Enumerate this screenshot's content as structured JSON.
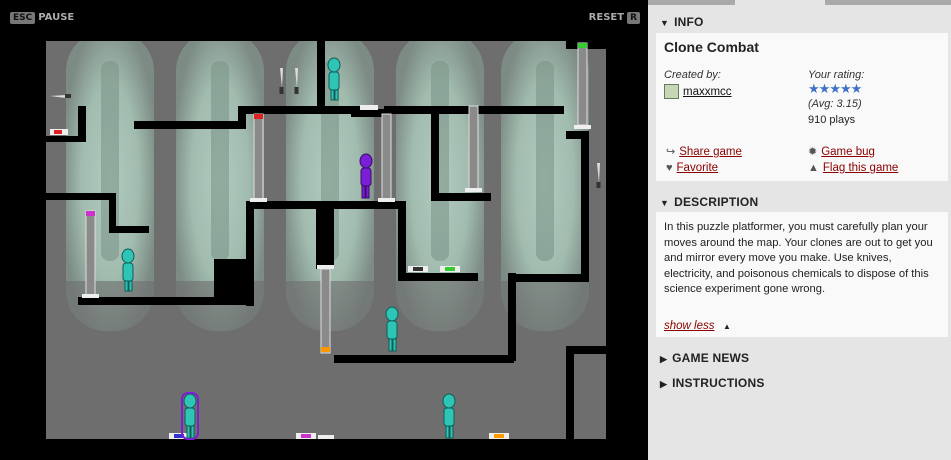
{
  "hud": {
    "esc_key": "ESC",
    "pause_label": "PAUSE",
    "reset_label": "RESET",
    "reset_key": "R"
  },
  "colors": {
    "link": "#8b0000",
    "clone_teal": "#2ec4b6",
    "player_purple": "#7b1fd6",
    "stars": "#3f72c4"
  },
  "info": {
    "header": "INFO",
    "title": "Clone Combat",
    "created_by_label": "Created by:",
    "author": "maxxmcc",
    "rating_label": "Your rating:",
    "avg": "(Avg: 3.15)",
    "plays": "910 plays",
    "stars": 5,
    "share": "Share game",
    "favorite": "Favorite",
    "bug": "Game bug",
    "flag": "Flag this game"
  },
  "description": {
    "header": "DESCRIPTION",
    "text": "In this puzzle platformer, you must carefully plan your moves around the map. Your clones are out to get you and mirror every move you make. Use knives, electricity, and poisonous chemicals to dispose of this science experiment gone wrong.",
    "show_less": "show less"
  },
  "sections": {
    "news": "GAME NEWS",
    "instructions": "INSTRUCTIONS"
  },
  "icons": [
    "share-icon",
    "heart-icon",
    "bug-icon",
    "flag-icon",
    "author-avatar-icon",
    "triangle-down-icon",
    "triangle-right-icon",
    "triangle-up-icon",
    "star-icon"
  ]
}
